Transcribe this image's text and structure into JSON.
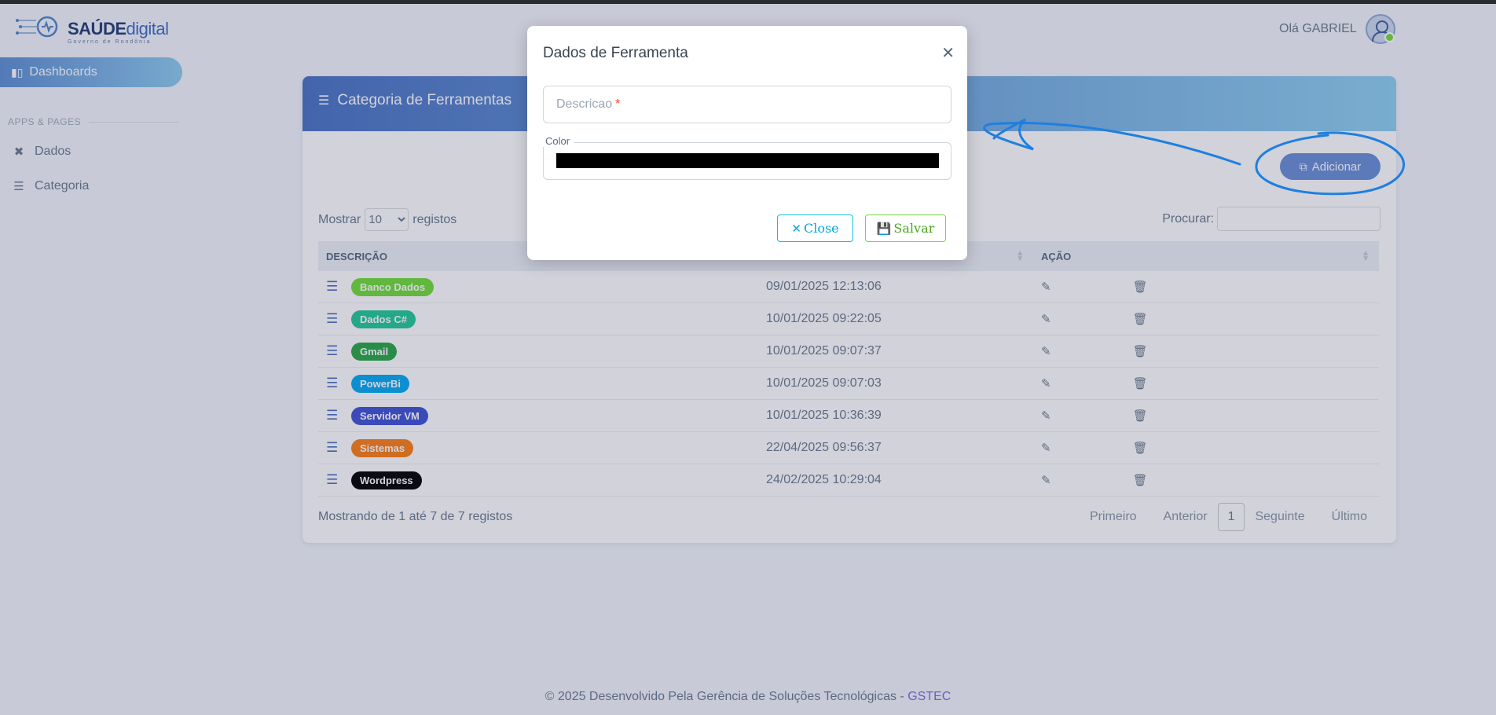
{
  "brand": {
    "name_bold": "SAÚDE",
    "name_light": "digital",
    "tagline": "Governo de Rondônia"
  },
  "sidebar": {
    "active_item": {
      "label": "Dashboards",
      "icon": "bar-chart-icon"
    },
    "section_label": "APPS & PAGES",
    "items": [
      {
        "label": "Dados",
        "icon": "tools-icon"
      },
      {
        "label": "Categoria",
        "icon": "layers-icon"
      }
    ]
  },
  "header": {
    "greeting": "Olá GABRIEL",
    "avatar_icon": "user-avatar-icon",
    "status_color": "#71dd37"
  },
  "card": {
    "title": "Categoria de Ferramentas",
    "add_button": "Adicionar",
    "show_prefix": "Mostrar",
    "show_value": "10",
    "show_options": [
      "10"
    ],
    "show_suffix": "registos",
    "search_label": "Procurar:",
    "columns": [
      "DESCRIÇÃO",
      "AÇÃO"
    ],
    "rows": [
      {
        "label": "Banco Dados",
        "color": "#71dd37",
        "date": "09/01/2025 12:13:06"
      },
      {
        "label": "Dados C#",
        "color": "#20c997",
        "date": "10/01/2025 09:22:05"
      },
      {
        "label": "Gmail",
        "color": "#28a745",
        "date": "10/01/2025 09:07:37"
      },
      {
        "label": "PowerBi",
        "color": "#03a9f4",
        "date": "10/01/2025 09:07:03"
      },
      {
        "label": "Servidor VM",
        "color": "#3f51d5",
        "date": "10/01/2025 10:36:39"
      },
      {
        "label": "Sistemas",
        "color": "#fd7e14",
        "date": "22/04/2025 09:56:37"
      },
      {
        "label": "Wordpress",
        "color": "#000000",
        "date": "24/02/2025 10:29:04"
      }
    ],
    "info": "Mostrando de 1 até 7 de 7 registos",
    "pager": {
      "first": "Primeiro",
      "prev": "Anterior",
      "current": "1",
      "next": "Seguinte",
      "last": "Último"
    }
  },
  "modal": {
    "title": "Dados de Ferramenta",
    "field_descricao": "Descricao",
    "required_mark": "*",
    "field_color_label": "Color",
    "color_value": "#000000",
    "close_label": "Close",
    "save_label": "Salvar"
  },
  "footer": {
    "text": "© 2025 Desenvolvido Pela Gerência de Soluções Tecnológicas - ",
    "link": "GSTEC"
  }
}
